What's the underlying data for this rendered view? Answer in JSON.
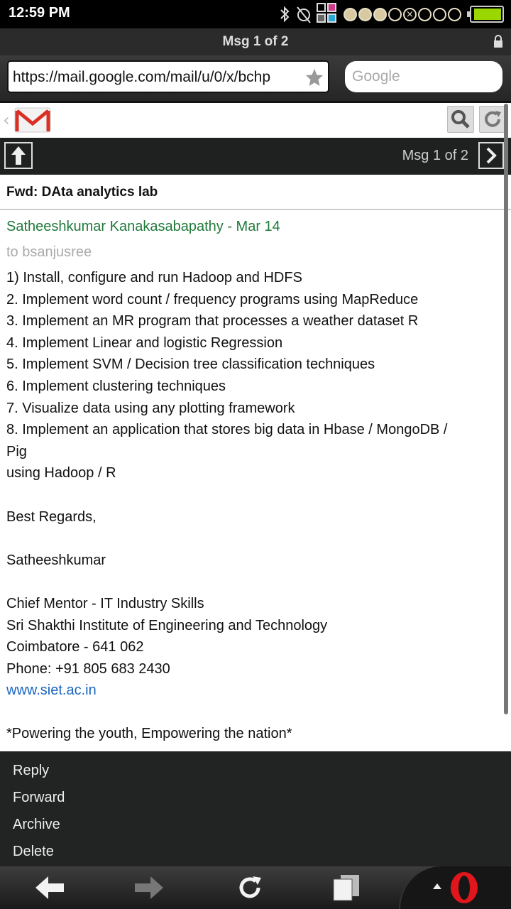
{
  "status_bar": {
    "time": "12:59 PM",
    "battery_level": 0.95
  },
  "browser": {
    "title": "Msg 1 of 2",
    "url": "https://mail.google.com/mail/u/0/x/bchp",
    "search_placeholder": "Google"
  },
  "nav": {
    "position_label": "Msg 1 of 2"
  },
  "email": {
    "subject": "Fwd: DAta analytics lab",
    "sender_line": "Satheeshkumar Kanakasabapathy - Mar 14",
    "recipient_line": "to bsanjusree",
    "body": [
      "1) Install, configure and run Hadoop and HDFS",
      "2. Implement word count / frequency programs using MapReduce",
      "3. Implement an MR program that processes a weather dataset R",
      "4. Implement Linear and logistic Regression",
      "5. Implement SVM / Decision tree classification techniques",
      "6. Implement clustering techniques",
      "7. Visualize data using any plotting framework",
      "8. Implement an application that stores big data in Hbase / MongoDB /",
      "Pig",
      "using Hadoop / R",
      "",
      "Best Regards,",
      "",
      "Satheeshkumar",
      "",
      "Chief Mentor - IT Industry Skills",
      "Sri Shakthi Institute of Engineering and Technology",
      "Coimbatore - 641 062",
      "Phone: +91 805 683 2430",
      "www.siet.ac.in",
      "",
      "*Powering the youth, Empowering the nation*"
    ]
  },
  "actions": {
    "reply": "Reply",
    "forward": "Forward",
    "archive": "Archive",
    "delete": "Delete"
  },
  "colors": {
    "sender_green": "#1f7a3a",
    "link_blue": "#1a66c0",
    "opera_red": "#e0161c",
    "battery_green": "#9ad600"
  }
}
